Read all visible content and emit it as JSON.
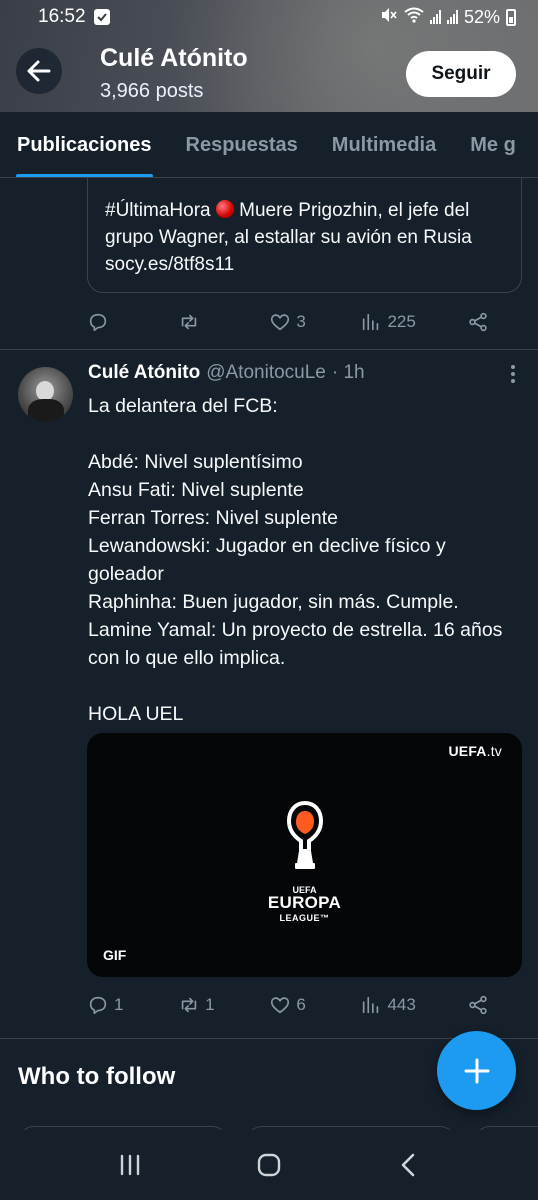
{
  "status_bar": {
    "time": "16:52",
    "battery": "52%"
  },
  "header": {
    "name": "Culé Atónito",
    "posts": "3,966 posts",
    "follow_label": "Seguir"
  },
  "tabs": [
    "Publicaciones",
    "Respuestas",
    "Multimedia",
    "Me g"
  ],
  "previous_post": {
    "quote_text_pre": "#ÚltimaHora",
    "quote_text_post": " Muere Prigozhin, el jefe del grupo Wagner, al estallar su avión en Rusia socy.es/8tf8s11",
    "actions": {
      "reply": "",
      "retweet": "",
      "like": "3",
      "views": "225"
    }
  },
  "tweet": {
    "name": "Culé Atónito",
    "handle": "@AtonitocuLe",
    "time": "· 1h",
    "lines": [
      "La delantera del FCB:",
      "",
      "Abdé: Nivel suplentísimo",
      "Ansu Fati: Nivel suplente",
      "Ferran Torres: Nivel suplente",
      "Lewandowski: Jugador en declive físico y goleador",
      "Raphinha: Buen jugador, sin más. Cumple.",
      "Lamine Yamal: Un proyecto de estrella. 16 años con lo que ello implica.",
      "",
      "HOLA UEL"
    ],
    "media": {
      "watermark_bold": "UEFA",
      "watermark_rest": ".tv",
      "logo_top": "UEFA",
      "logo_main": "EUROPA",
      "logo_bottom": "LEAGUE™",
      "badge": "GIF"
    },
    "actions": {
      "reply": "1",
      "retweet": "1",
      "like": "6",
      "views": "443"
    }
  },
  "who_to_follow": "Who to follow",
  "colors": {
    "accent": "#1d9bf0",
    "background": "#15202b",
    "border": "#38444d",
    "muted": "#8b98a5",
    "trophy_orange": "#ff5a1f"
  }
}
